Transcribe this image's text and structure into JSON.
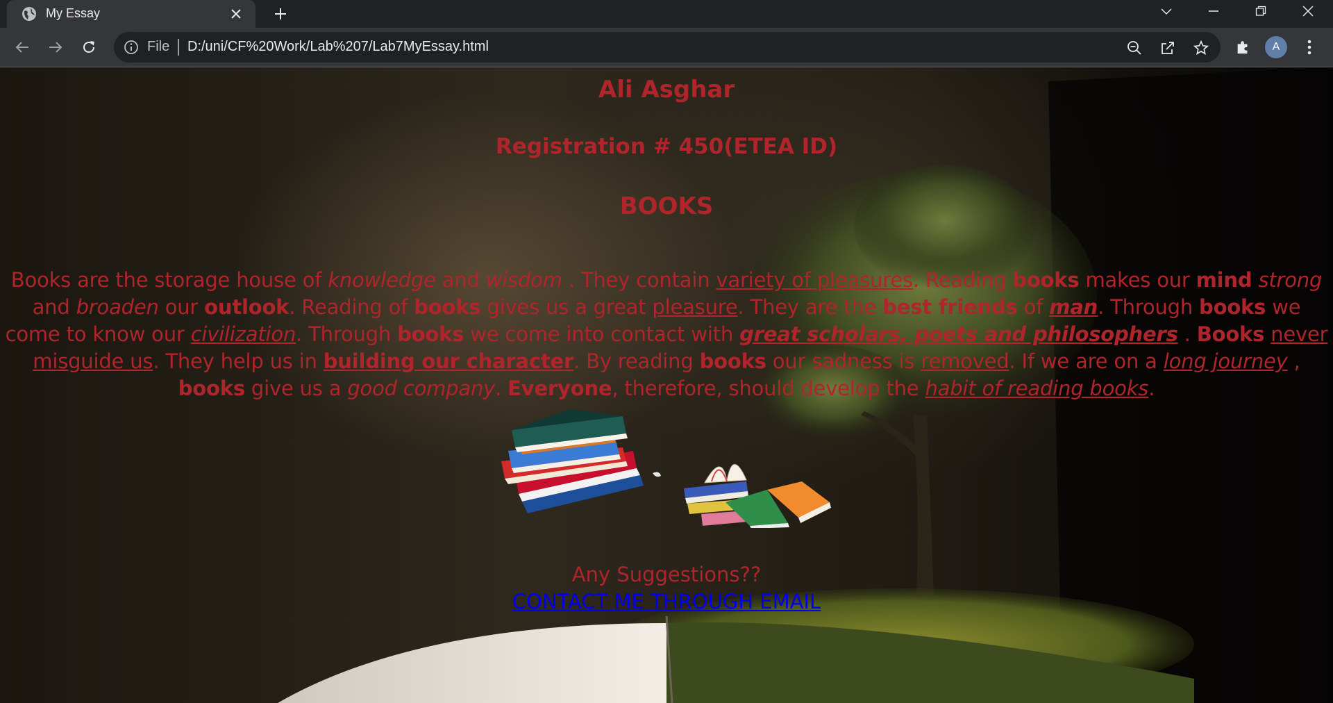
{
  "browser": {
    "tab_title": "My Essay",
    "address_scheme_label": "File",
    "url": "D:/uni/CF%20Work/Lab%207/Lab7MyEssay.html",
    "profile_initial": "A"
  },
  "page": {
    "author": "Ali Asghar",
    "registration": "Registration # 450(ETEA ID)",
    "topic": "BOOKS",
    "paragraph": {
      "s01": "Books are the storage house of ",
      "s02": "knowledge",
      "s03": " and ",
      "s04": "wisdom",
      "s05": " . They contain ",
      "s06": "variety of pleasures",
      "s07": ". Reading ",
      "s08": "books",
      "s09": " makes our ",
      "s10": "mind",
      "s11": " ",
      "s12": "strong",
      "s13": " and ",
      "s14": "broaden",
      "s15": " our ",
      "s16": "outlook",
      "s17": ". Reading of ",
      "s18": "books",
      "s19": " gives us a great ",
      "s20": "pleasure",
      "s21": ". They are the ",
      "s22": "best friends",
      "s23": " of ",
      "s24": "man",
      "s25": ". Through ",
      "s26": "books",
      "s27": " we come to know our ",
      "s28": "civilization",
      "s29": ". Through ",
      "s30": "books",
      "s31": " we come into contact with ",
      "s32": "great scholars, poets and philosophers",
      "s33": " . ",
      "s34": "Books",
      "s35": " ",
      "s36": "never misguide us",
      "s37": ". They help us in ",
      "s38": "building our character",
      "s39": ". By reading ",
      "s40": "books",
      "s41": " our sadness is ",
      "s42": "removed",
      "s43": ". If we are on a ",
      "s44": "long journey",
      "s45": " , ",
      "s46": "books",
      "s47": " give us a ",
      "s48": "good company",
      "s49": ". ",
      "s50": "Everyone",
      "s51": ", therefore, should develop the ",
      "s52": "habit of reading books",
      "s53": "."
    },
    "suggestions": "Any Suggestions??",
    "contact_link": "CONTACT ME THROUGH EMAIL"
  },
  "icons": {
    "tab": [
      "globe-icon",
      "close-icon",
      "plus-icon"
    ],
    "window": [
      "chevron-down-icon",
      "minimize-icon",
      "restore-icon",
      "close-window-icon"
    ],
    "toolbar": [
      "back-arrow-icon",
      "forward-arrow-icon",
      "reload-icon",
      "info-icon",
      "zoom-out-icon",
      "share-icon",
      "star-icon",
      "puzzle-icon",
      "kebab-menu-icon"
    ]
  },
  "colors": {
    "text_red": "#b0242b",
    "link_blue": "#0000ee",
    "chrome_dark": "#202124",
    "chrome_toolbar": "#35363a"
  }
}
